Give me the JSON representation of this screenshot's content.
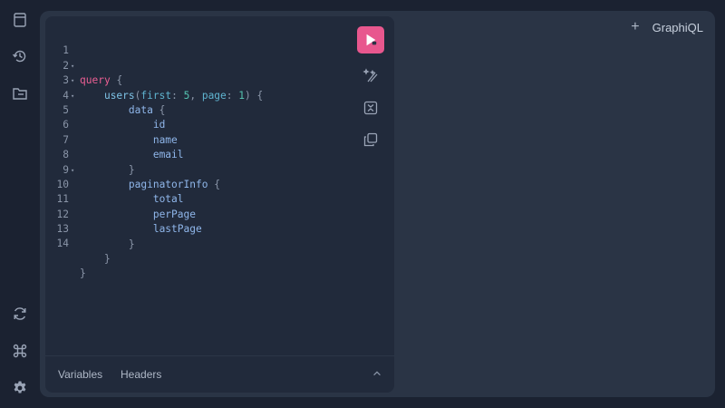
{
  "app": {
    "title": "GraphiQL"
  },
  "header": {
    "add_tab_label": "+"
  },
  "sidebar": {
    "top_icons": [
      "docs-icon",
      "history-icon",
      "explorer-folder-icon"
    ],
    "bottom_icons": [
      "refetch-schema-icon",
      "shortcuts-icon",
      "settings-icon"
    ]
  },
  "editor": {
    "lines": [
      {
        "n": "1",
        "fold": "▾"
      },
      {
        "n": "2",
        "fold": "▾"
      },
      {
        "n": "3",
        "fold": "▾"
      },
      {
        "n": "4",
        "fold": ""
      },
      {
        "n": "5",
        "fold": ""
      },
      {
        "n": "6",
        "fold": ""
      },
      {
        "n": "7",
        "fold": ""
      },
      {
        "n": "8",
        "fold": "▾"
      },
      {
        "n": "9",
        "fold": ""
      },
      {
        "n": "10",
        "fold": ""
      },
      {
        "n": "11",
        "fold": ""
      },
      {
        "n": "12",
        "fold": ""
      },
      {
        "n": "13",
        "fold": ""
      },
      {
        "n": "14",
        "fold": ""
      }
    ],
    "tokens": {
      "query_kw": "query",
      "brace_open": "{",
      "brace_close": "}",
      "users": "users",
      "paren_open": "(",
      "paren_close": ")",
      "first": "first",
      "colon": ":",
      "first_val": "5",
      "comma": ",",
      "page": "page",
      "page_val": "1",
      "data": "data",
      "id": "id",
      "name": "name",
      "email": "email",
      "paginatorInfo": "paginatorInfo",
      "total": "total",
      "perPage": "perPage",
      "lastPage": "lastPage"
    }
  },
  "bottom_tabs": {
    "variables": "Variables",
    "headers": "Headers"
  },
  "colors": {
    "accent": "#e8578e",
    "keyword": "#ec5f94",
    "field": "#8fb6ea"
  }
}
